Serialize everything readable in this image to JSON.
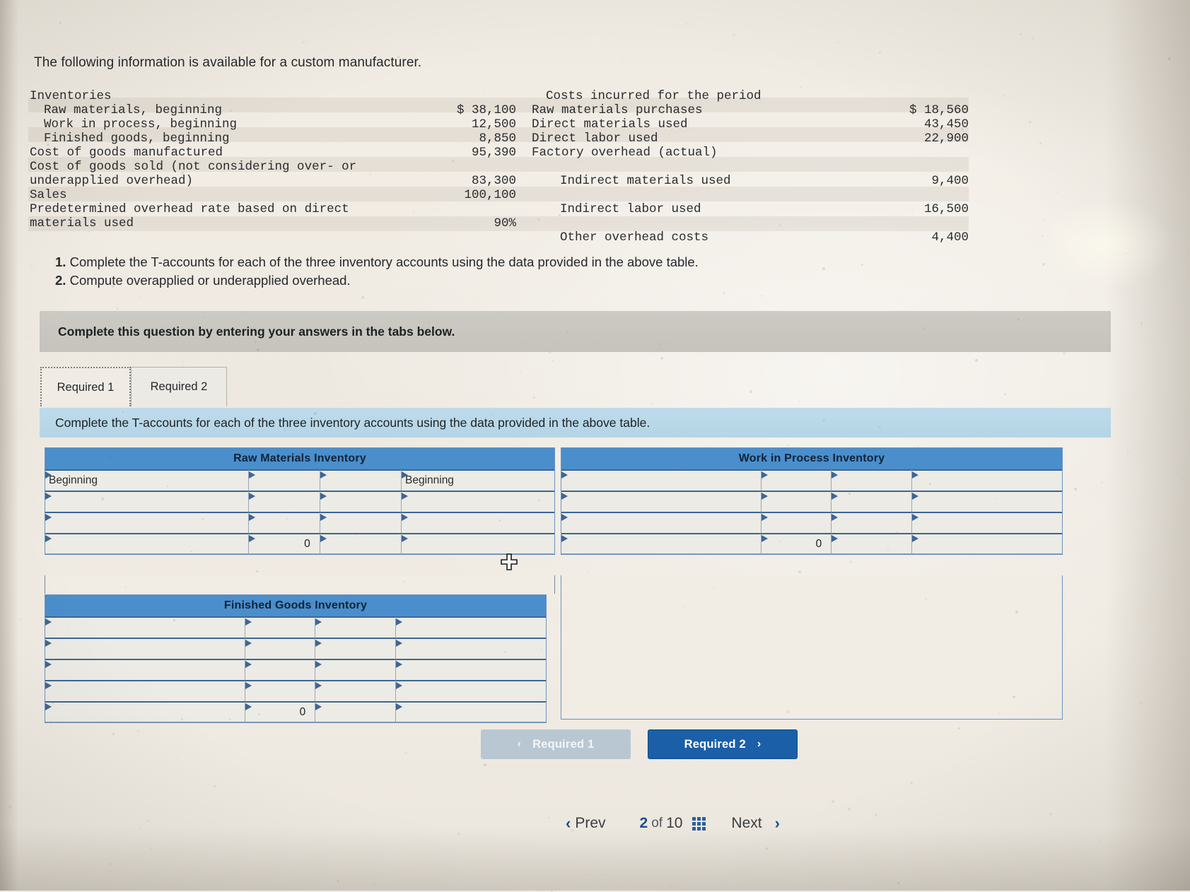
{
  "intro": "The following information is available for a custom manufacturer.",
  "info_table": {
    "left": {
      "header": "Inventories",
      "rows": [
        {
          "label": "Raw materials, beginning",
          "value": "$ 38,100",
          "indent": 1
        },
        {
          "label": "Work in process, beginning",
          "value": "12,500",
          "indent": 1
        },
        {
          "label": "Finished goods, beginning",
          "value": "8,850",
          "indent": 1
        },
        {
          "label": "Cost of goods manufactured",
          "value": "95,390",
          "indent": 0
        },
        {
          "label": "Cost of goods sold (not considering over- or underapplied overhead)",
          "value": "83,300",
          "indent": 0
        },
        {
          "label": "Sales",
          "value": "100,100",
          "indent": 0
        },
        {
          "label": "Predetermined overhead rate based on direct materials used",
          "value": "90%",
          "indent": 0
        }
      ]
    },
    "right": {
      "header": "Costs incurred for the period",
      "rows": [
        {
          "label": "Raw materials purchases",
          "value": "$ 18,560",
          "indent": 1
        },
        {
          "label": "Direct materials used",
          "value": "43,450",
          "indent": 1
        },
        {
          "label": "Direct labor used",
          "value": "22,900",
          "indent": 1
        },
        {
          "label": "Factory overhead (actual)",
          "value": "",
          "indent": 1
        },
        {
          "label": "Indirect materials used",
          "value": "9,400",
          "indent": 2
        },
        {
          "label": "Indirect labor used",
          "value": "16,500",
          "indent": 2
        },
        {
          "label": "Other overhead costs",
          "value": "4,400",
          "indent": 2
        }
      ]
    }
  },
  "steps": [
    {
      "num": "1.",
      "text": "Complete the T-accounts for each of the three inventory accounts using the data provided in the above table."
    },
    {
      "num": "2.",
      "text": "Compute overapplied or underapplied overhead."
    }
  ],
  "banner": "Complete this question by entering your answers in the tabs below.",
  "tabs": [
    {
      "label": "Required 1",
      "active": true
    },
    {
      "label": "Required 2",
      "active": false
    }
  ],
  "substrip": "Complete the T-accounts for each of the three inventory accounts using the data provided in the above table.",
  "taccounts": [
    {
      "id": "raw-materials-inventory",
      "title": "Raw Materials Inventory",
      "rows": [
        {
          "cells": [
            "Beginning",
            "",
            "",
            "Beginning"
          ]
        },
        {
          "cells": [
            "",
            "",
            "",
            ""
          ]
        },
        {
          "cells": [
            "",
            "",
            "",
            ""
          ]
        },
        {
          "cells": [
            "",
            "0",
            "",
            ""
          ]
        }
      ]
    },
    {
      "id": "work-in-process-inventory",
      "title": "Work in Process Inventory",
      "rows": [
        {
          "cells": [
            "",
            "",
            "",
            ""
          ]
        },
        {
          "cells": [
            "",
            "",
            "",
            ""
          ]
        },
        {
          "cells": [
            "",
            "",
            "",
            ""
          ]
        },
        {
          "cells": [
            "",
            "0",
            "",
            ""
          ]
        }
      ]
    },
    {
      "id": "finished-goods-inventory",
      "title": "Finished Goods Inventory",
      "rows": [
        {
          "cells": [
            "",
            "",
            "",
            ""
          ]
        },
        {
          "cells": [
            "",
            "",
            "",
            ""
          ]
        },
        {
          "cells": [
            "",
            "",
            "",
            ""
          ]
        },
        {
          "cells": [
            "",
            "",
            "",
            ""
          ]
        },
        {
          "cells": [
            "",
            "0",
            "",
            ""
          ]
        }
      ]
    }
  ],
  "req_nav": {
    "prev_label": "Required 1",
    "prev_chevron": "‹",
    "next_label": "Required 2",
    "next_chevron": "›"
  },
  "pager": {
    "prev_chevron": "‹",
    "prev_label": "Prev",
    "current": "2",
    "of": "of",
    "total": "10",
    "next_label": "Next",
    "next_chevron": "›",
    "grid_icon": "grid-icon"
  },
  "colors": {
    "header_blue": "#4a8ecb",
    "primary_button": "#1b5fa8",
    "disabled_button": "#b9c7d2",
    "substrip_blue": "#bedbea",
    "banner_grey": "#cdcac4"
  }
}
